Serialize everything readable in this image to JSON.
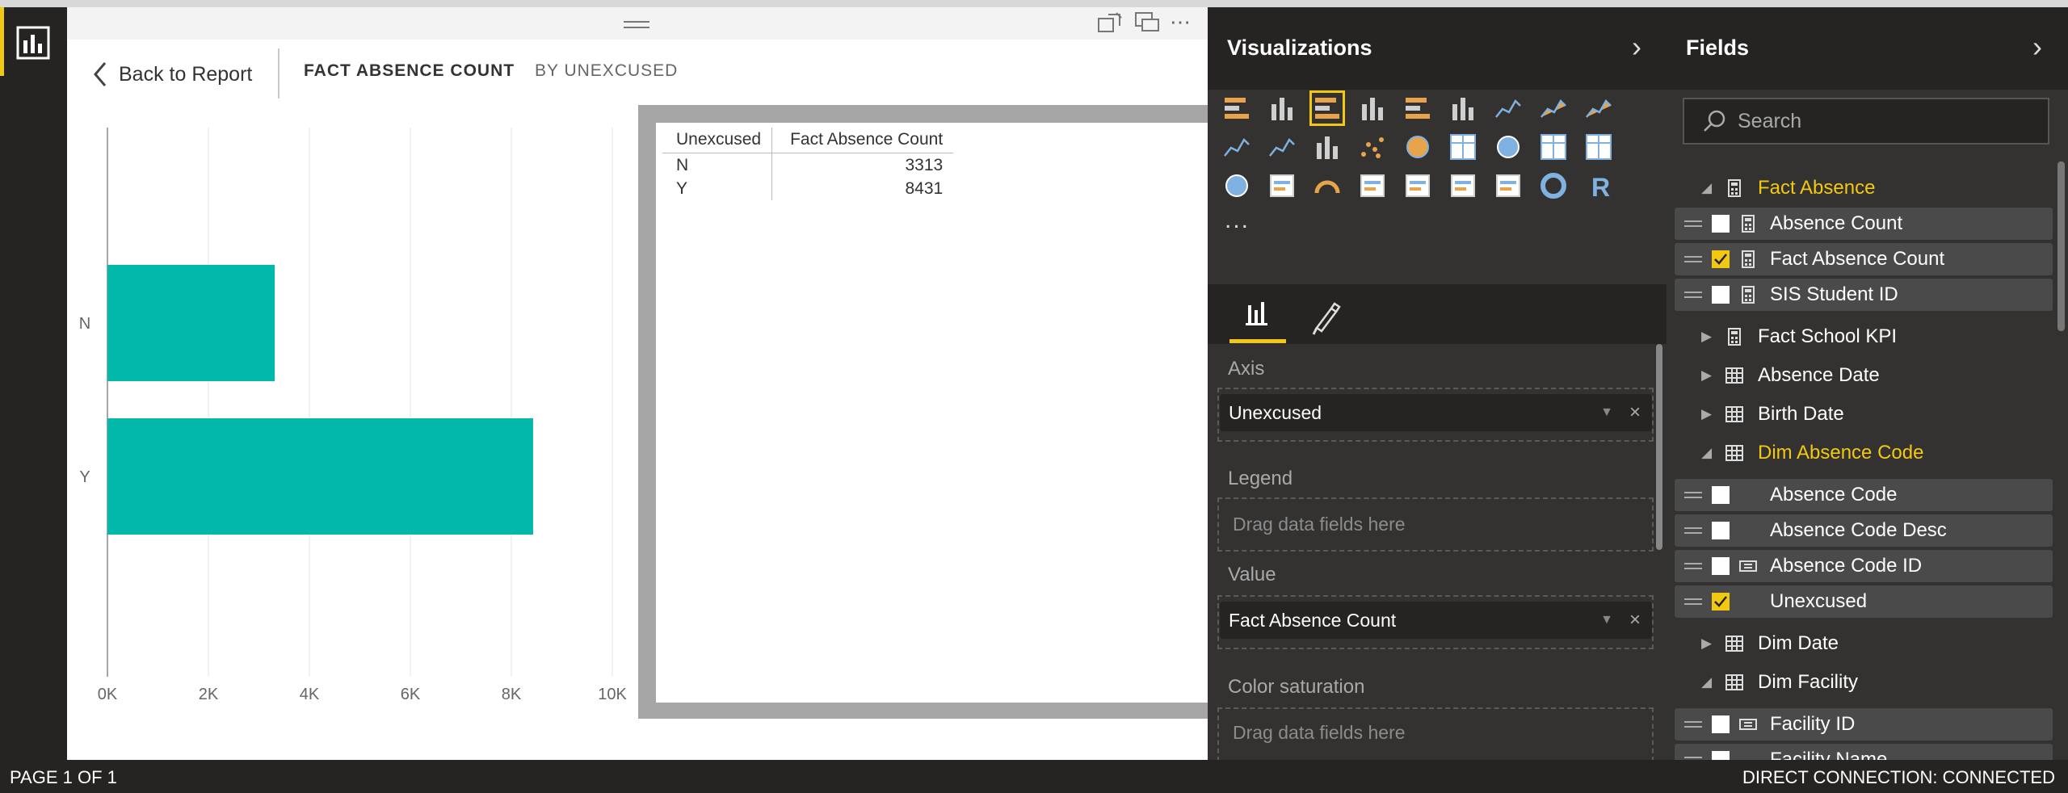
{
  "header": {
    "back_label": "Back to Report",
    "title": "FACT ABSENCE COUNT",
    "subtitle": "BY UNEXCUSED"
  },
  "chart_data": {
    "type": "bar",
    "orientation": "horizontal",
    "categories": [
      "N",
      "Y"
    ],
    "values": [
      3313,
      8431
    ],
    "xticks": [
      "0K",
      "2K",
      "4K",
      "6K",
      "8K",
      "10K"
    ],
    "xlim": [
      0,
      10000
    ],
    "bar_color": "#01b8aa",
    "grid": true
  },
  "table": {
    "headers": [
      "Unexcused",
      "Fact Absence Count"
    ],
    "rows": [
      {
        "key": "N",
        "value": "3313"
      },
      {
        "key": "Y",
        "value": "8431"
      }
    ]
  },
  "visualizations": {
    "title": "Visualizations",
    "more": "...",
    "icons": [
      "stacked-bar-chart-icon",
      "stacked-column-chart-icon",
      "clustered-bar-chart-icon",
      "clustered-column-chart-icon",
      "100-stacked-bar-chart-icon",
      "100-stacked-column-chart-icon",
      "line-chart-icon",
      "area-chart-icon",
      "stacked-area-chart-icon",
      "line-and-stacked-column-chart-icon",
      "line-and-clustered-column-chart-icon",
      "ribbon-chart-icon",
      "scatter-chart-icon",
      "pie-chart-icon",
      "treemap-icon",
      "map-icon",
      "table-icon",
      "matrix-icon",
      "filled-map-icon",
      "funnel-icon",
      "gauge-icon",
      "multi-row-card-icon",
      "card-icon",
      "kpi-icon",
      "slicer-icon",
      "donut-chart-icon",
      "r-visual-icon"
    ],
    "selected_icon": "clustered-bar-chart-icon",
    "wells": {
      "axis_label": "Axis",
      "axis_value": "Unexcused",
      "legend_label": "Legend",
      "legend_placeholder": "Drag data fields here",
      "value_label": "Value",
      "value_value": "Fact Absence Count",
      "saturation_label": "Color saturation",
      "saturation_placeholder": "Drag data fields here"
    }
  },
  "fields": {
    "title": "Fields",
    "search_placeholder": "Search",
    "rows": [
      {
        "kind": "table",
        "label": "Fact Absence",
        "expanded": true,
        "icon": "calculator-icon",
        "highlight": true
      },
      {
        "kind": "field",
        "label": "Absence Count",
        "checked": false,
        "icon": "calculator-icon"
      },
      {
        "kind": "field",
        "label": "Fact Absence Count",
        "checked": true,
        "icon": "calculator-icon"
      },
      {
        "kind": "field",
        "label": "SIS Student ID",
        "checked": false,
        "icon": "calculator-icon"
      },
      {
        "kind": "table",
        "label": "Fact School KPI",
        "expanded": false,
        "icon": "calculator-icon",
        "highlight": false
      },
      {
        "kind": "table",
        "label": "Absence Date",
        "expanded": false,
        "icon": "table-icon",
        "highlight": false
      },
      {
        "kind": "table",
        "label": "Birth Date",
        "expanded": false,
        "icon": "table-icon",
        "highlight": false
      },
      {
        "kind": "table",
        "label": "Dim Absence Code",
        "expanded": true,
        "icon": "table-icon",
        "highlight": true
      },
      {
        "kind": "field",
        "label": "Absence Code",
        "checked": false,
        "icon": "none"
      },
      {
        "kind": "field",
        "label": "Absence Code Desc",
        "checked": false,
        "icon": "none"
      },
      {
        "kind": "field",
        "label": "Absence Code ID",
        "checked": false,
        "icon": "key-icon"
      },
      {
        "kind": "field",
        "label": "Unexcused",
        "checked": true,
        "icon": "none"
      },
      {
        "kind": "table",
        "label": "Dim Date",
        "expanded": false,
        "icon": "table-icon",
        "highlight": false
      },
      {
        "kind": "table",
        "label": "Dim Facility",
        "expanded": true,
        "icon": "table-icon",
        "highlight": false
      },
      {
        "kind": "field",
        "label": "Facility ID",
        "checked": false,
        "icon": "key-icon"
      },
      {
        "kind": "field",
        "label": "Facility Name",
        "checked": false,
        "icon": "none"
      }
    ]
  },
  "status": {
    "page": "PAGE 1 OF 1",
    "connection": "DIRECT CONNECTION: CONNECTED"
  }
}
